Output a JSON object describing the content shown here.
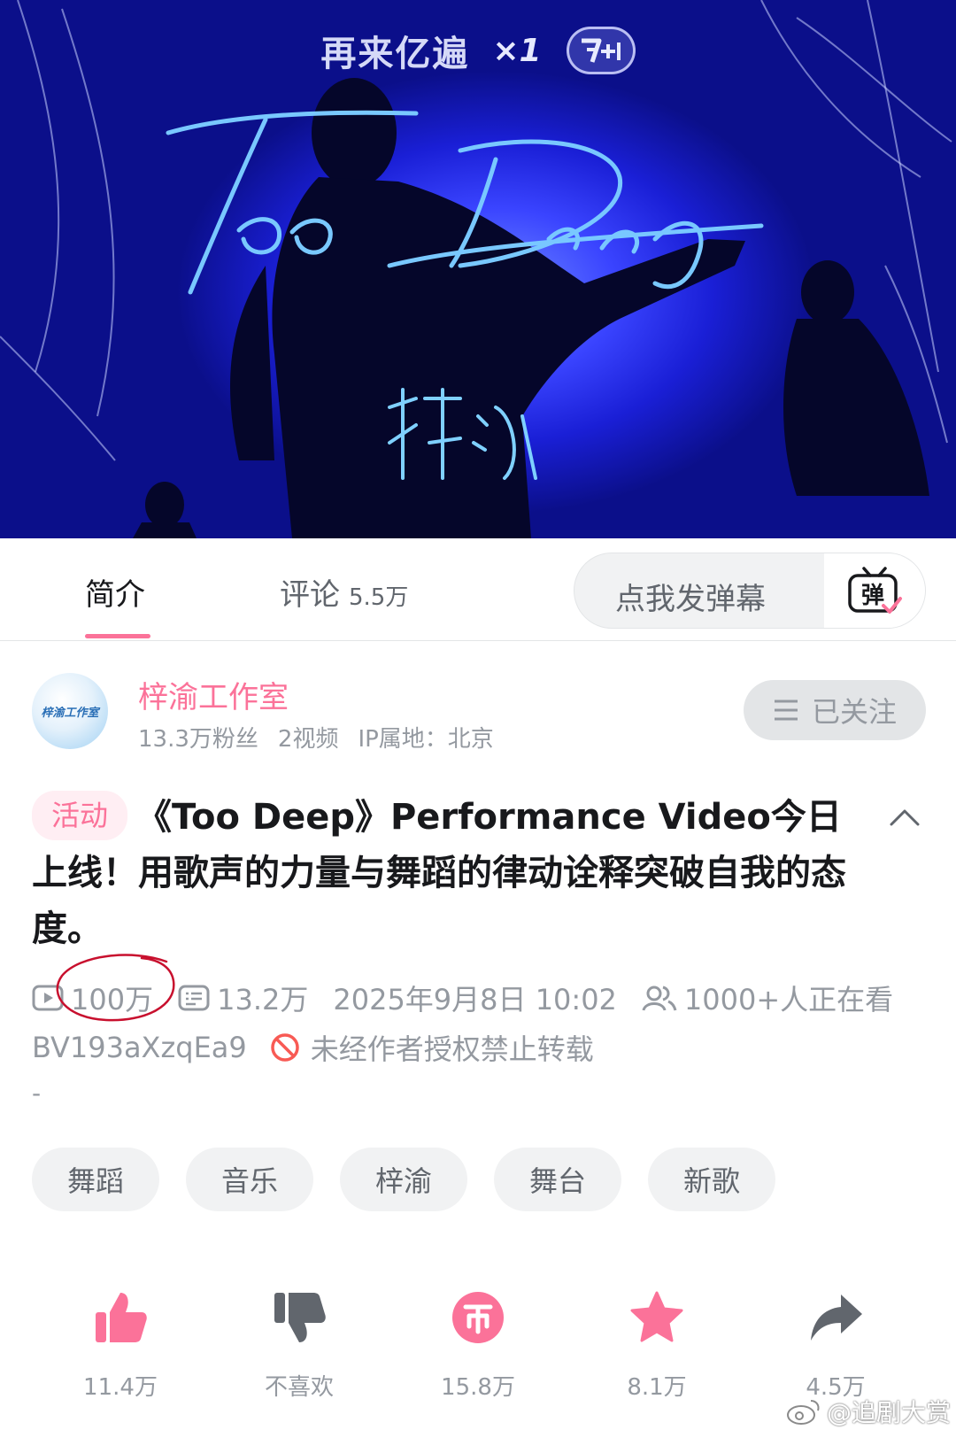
{
  "video": {
    "promo_text": "再来亿遍",
    "promo_count": "×1",
    "promo_badge": "+1",
    "title_art": "Too Deep",
    "artist_art": "梓渝"
  },
  "tabs": [
    {
      "label": "简介",
      "active": true
    },
    {
      "label": "评论",
      "count": "5.5万",
      "active": false
    }
  ],
  "danmaku": {
    "placeholder": "点我发弹幕",
    "button_glyph": "弹"
  },
  "uploader": {
    "name": "梓渝工作室",
    "avatar_text": "梓渝工作室",
    "fans": "13.3万粉丝",
    "videos": "2视频",
    "ip": "IP属地：北京",
    "follow_label": "已关注"
  },
  "title": {
    "tag": "活动",
    "text": "《Too Deep》Performance Video今日上线！用歌声的力量与舞蹈的律动诠释突破自我的态度。"
  },
  "stats": {
    "plays": "100万",
    "danmaku_count": "13.2万",
    "datetime": "2025年9月8日 10:02",
    "watching": "1000+人正在看",
    "bvid": "BV193aXzqEa9",
    "copyright": "未经作者授权禁止转载",
    "dash": "-"
  },
  "tags": [
    "舞蹈",
    "音乐",
    "梓渝",
    "舞台",
    "新歌"
  ],
  "actions": [
    {
      "name": "like",
      "label": "11.4万"
    },
    {
      "name": "dislike",
      "label": "不喜欢"
    },
    {
      "name": "coin",
      "label": "15.8万"
    },
    {
      "name": "favorite",
      "label": "8.1万"
    },
    {
      "name": "share",
      "label": "4.5万"
    }
  ],
  "watermark": "@追剧大赏",
  "colors": {
    "accent_pink": "#fb7299",
    "text_primary": "#18191c",
    "text_secondary": "#9499a0",
    "video_blue": "#1a1fd6",
    "annotation_red": "#c8102e"
  }
}
